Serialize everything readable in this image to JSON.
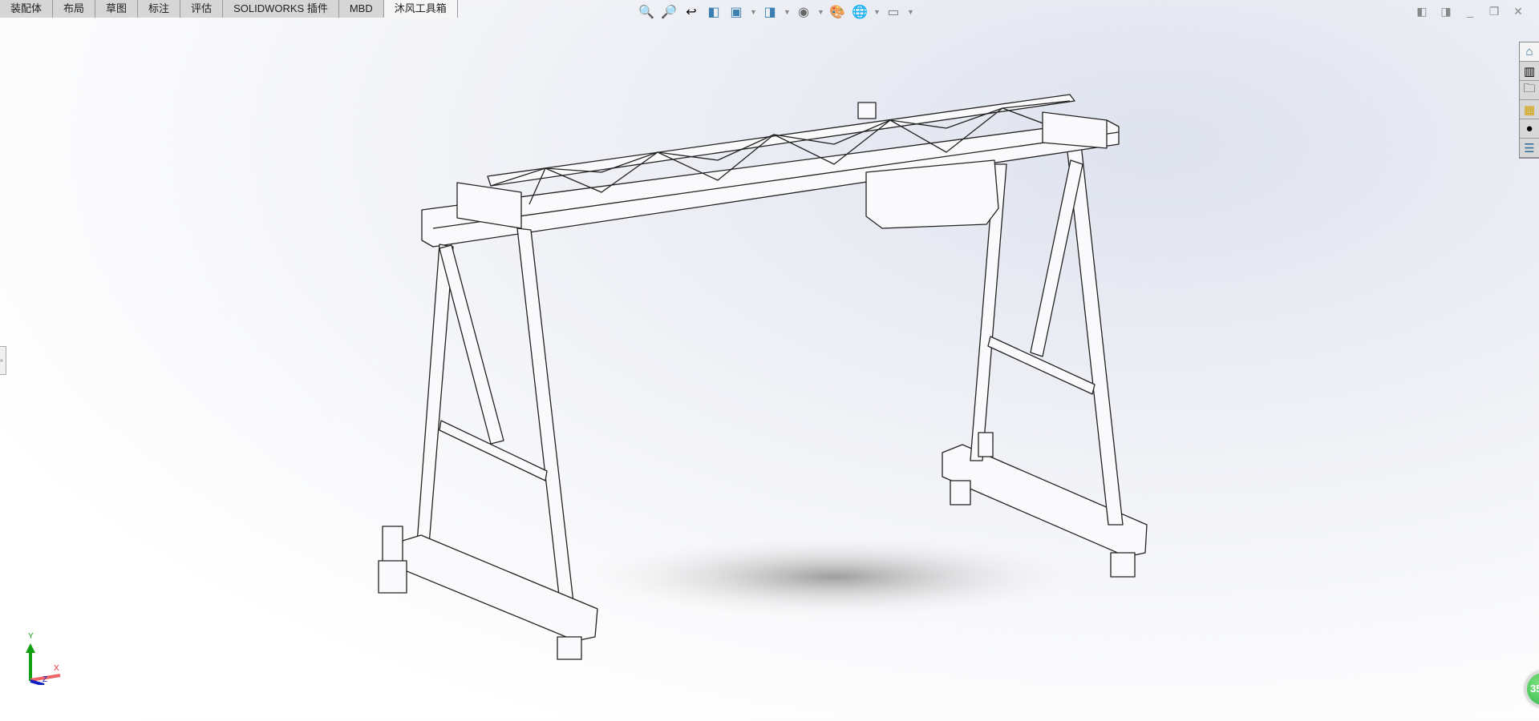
{
  "tabs": [
    {
      "label": "装配体"
    },
    {
      "label": "布局"
    },
    {
      "label": "草图"
    },
    {
      "label": "标注"
    },
    {
      "label": "评估"
    },
    {
      "label": "SOLIDWORKS 插件"
    },
    {
      "label": "MBD"
    },
    {
      "label": "沐风工具箱",
      "active": true
    }
  ],
  "toolbar": [
    "zoom-to-fit-icon",
    "zoom-to-area-icon",
    "previous-view-icon",
    "section-view-icon",
    "view-orientation-icon",
    "display-style-icon",
    "hide-show-items-icon",
    "edit-appearance-icon",
    "apply-scene-icon",
    "view-settings-icon"
  ],
  "taskpane": [
    "home-icon",
    "design-library-icon",
    "file-explorer-icon",
    "view-palette-icon",
    "appearances-icon",
    "custom-properties-icon"
  ],
  "triad": {
    "y": "Y",
    "x": "X",
    "z": "Z"
  },
  "badge": {
    "text": "35"
  },
  "colors": {
    "x_axis": "#e03030",
    "y_axis": "#10a010",
    "z_axis": "#1020c0",
    "badge": "#3cc350"
  }
}
